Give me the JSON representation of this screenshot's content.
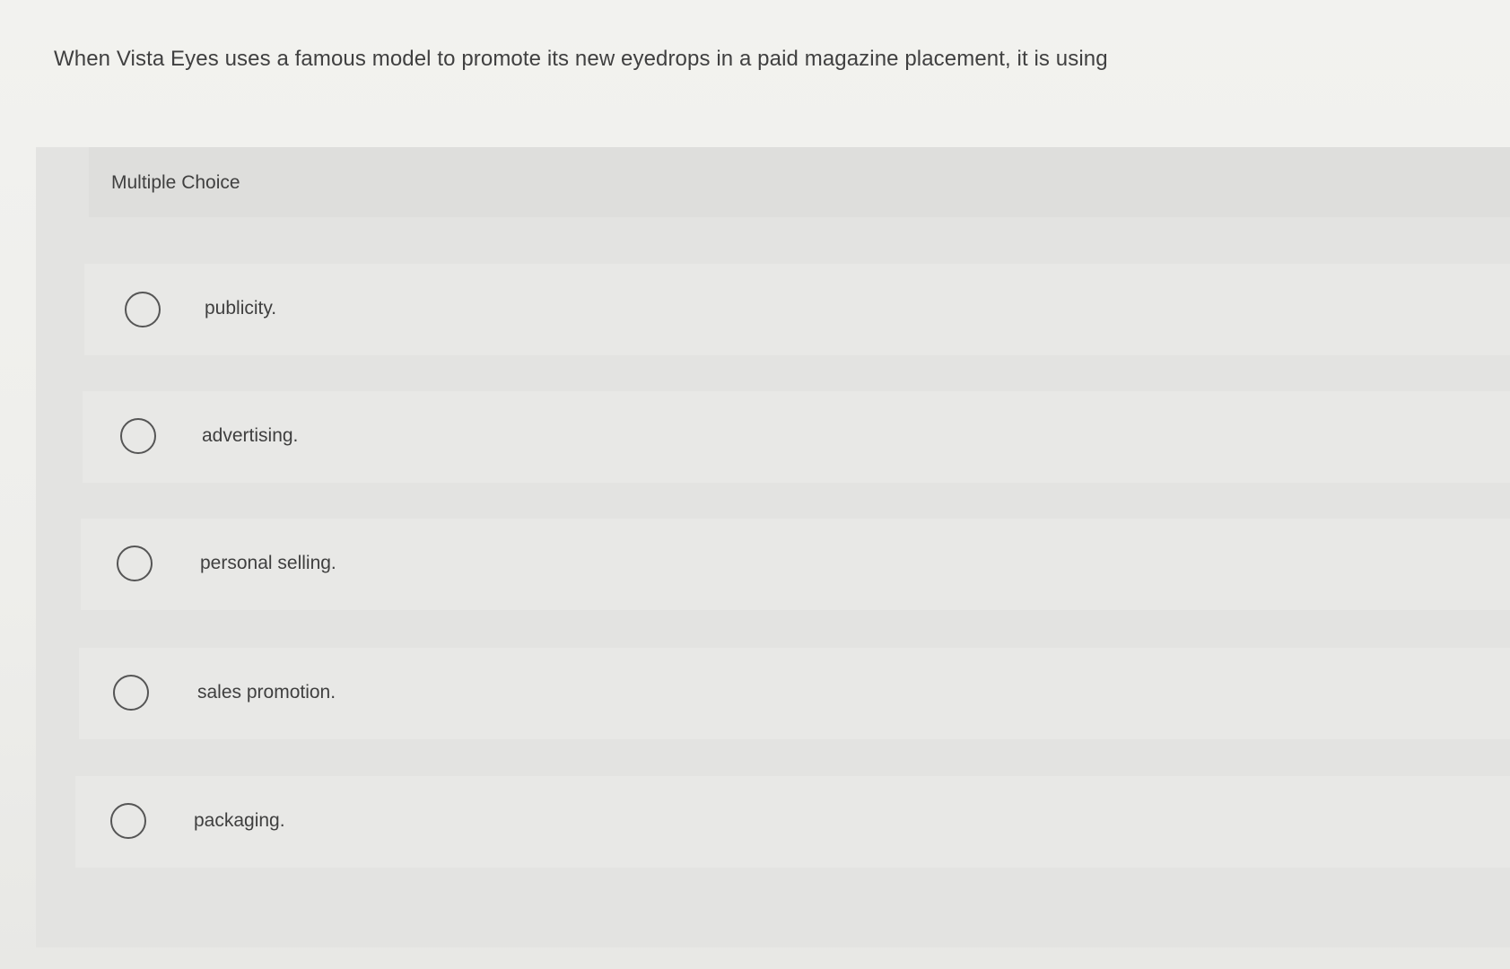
{
  "question": {
    "text": "When Vista Eyes uses a famous model to promote its new eyedrops in a paid magazine placement, it is using"
  },
  "card": {
    "label": "Multiple Choice"
  },
  "options": [
    {
      "label": "publicity.",
      "selected": false
    },
    {
      "label": "advertising.",
      "selected": false
    },
    {
      "label": "personal selling.",
      "selected": false
    },
    {
      "label": "sales promotion.",
      "selected": false
    },
    {
      "label": "packaging.",
      "selected": false
    }
  ]
}
